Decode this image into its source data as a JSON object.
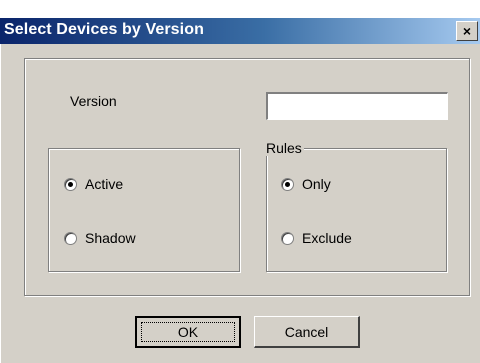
{
  "window": {
    "title": "Select Devices by Version",
    "close_glyph": "×"
  },
  "version": {
    "label": "Version",
    "value": ""
  },
  "status_group": {
    "options": [
      {
        "label": "Active",
        "checked": true
      },
      {
        "label": "Shadow",
        "checked": false
      }
    ]
  },
  "rules_group": {
    "legend": "Rules",
    "options": [
      {
        "label": "Only",
        "checked": true
      },
      {
        "label": "Exclude",
        "checked": false
      }
    ]
  },
  "buttons": {
    "ok": "OK",
    "cancel": "Cancel"
  }
}
